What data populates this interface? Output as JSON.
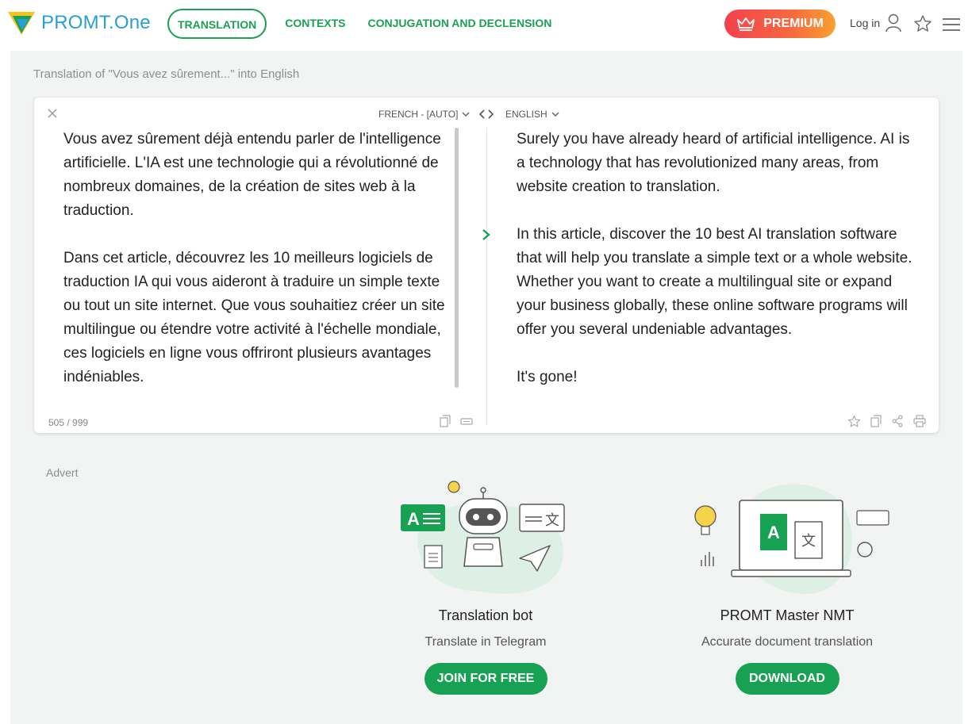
{
  "header": {
    "logo_text": "PROMT.One",
    "nav": [
      {
        "label": "TRANSLATION",
        "active": true
      },
      {
        "label": "CONTEXTS",
        "active": false
      },
      {
        "label": "CONJUGATION AND DECLENSION",
        "active": false
      }
    ],
    "premium_label": "PREMIUM",
    "login_label": "Log in",
    "icons": {
      "crown": "crown-icon",
      "user": "user-icon",
      "star": "star-icon",
      "menu": "hamburger-menu-icon"
    }
  },
  "breadcrumb": "Translation of \"Vous avez sûrement...\" into English",
  "translator": {
    "source_lang": "FRENCH - [AUTO]",
    "target_lang": "ENGLISH",
    "source_paragraphs": [
      "Vous avez sûrement déjà entendu parler de l'intelligence artificielle. L'IA est une technologie qui a révolutionné de nombreux domaines, de la création de sites web à la traduction.",
      "Dans cet article, découvrez les 10 meilleurs logiciels de traduction IA qui vous aideront à traduire un simple texte ou tout un site internet. Que vous souhaitiez créer un site multilingue ou étendre votre activité à l'échelle mondiale, ces logiciels en ligne vous offriront plusieurs avantages indéniables."
    ],
    "target_paragraphs": [
      "Surely you have already heard of artificial intelligence. AI is a technology that has revolutionized many areas, from website creation to translation.",
      "In this article, discover the 10 best AI translation software that will help you translate a simple text or a whole website. Whether you want to create a multilingual site or expand your business globally, these online software programs will offer you several undeniable advantages.",
      "It's gone!"
    ],
    "char_counter": "505 / 999"
  },
  "advert": {
    "label": "Advert",
    "promos": [
      {
        "title": "Translation bot",
        "subtitle": "Translate in Telegram",
        "button": "JOIN FOR FREE"
      },
      {
        "title": "PROMT Master NMT",
        "subtitle": "Accurate document translation",
        "button": "DOWNLOAD"
      }
    ]
  },
  "colors": {
    "brand_green": "#17a152",
    "brand_blue": "#2a9fd6",
    "premium_start": "#f4404e",
    "premium_end": "#f9a12f",
    "page_bg": "#f2f3f3"
  }
}
